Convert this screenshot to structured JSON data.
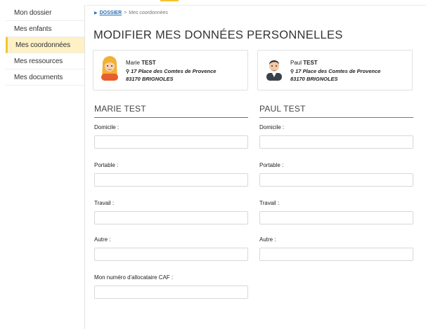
{
  "sidebar": {
    "items": [
      {
        "label": "Mon dossier",
        "active": false
      },
      {
        "label": "Mes enfants",
        "active": false
      },
      {
        "label": "Mes coordonnées",
        "active": true
      },
      {
        "label": "Mes ressources",
        "active": false
      },
      {
        "label": "Mes documents",
        "active": false
      }
    ]
  },
  "breadcrumb": {
    "root": "DOSSIER",
    "sep": ">",
    "current": "Mes coordonnées"
  },
  "page": {
    "title": "MODIFIER MES DONNÉES PERSONNELLES"
  },
  "cards": [
    {
      "first": "Marie",
      "last": "TEST",
      "street": "17 Place des Comtes de Provence",
      "city": "83170 BRIGNOLES",
      "avatar": "female-avatar-icon"
    },
    {
      "first": "Paul",
      "last": "TEST",
      "street": "17 Place des Comtes de Provence",
      "city": "83170 BRIGNOLES",
      "avatar": "male-avatar-icon"
    }
  ],
  "forms": [
    {
      "title": "MARIE TEST",
      "rule_color": "#c0504d",
      "fields": [
        {
          "label": "Domicile :",
          "value": ""
        },
        {
          "label": "Portable :",
          "value": ""
        },
        {
          "label": "Travail :",
          "value": ""
        },
        {
          "label": "Autre :",
          "value": ""
        },
        {
          "label": "Mon numéro d'allocataire CAF :",
          "value": ""
        }
      ]
    },
    {
      "title": "PAUL TEST",
      "rule_color": "#4f81bd",
      "fields": [
        {
          "label": "Domicile :",
          "value": ""
        },
        {
          "label": "Portable :",
          "value": ""
        },
        {
          "label": "Travail :",
          "value": ""
        },
        {
          "label": "Autre :",
          "value": ""
        }
      ]
    }
  ],
  "colors": {
    "accent": "#f4c431",
    "active_bg": "#fdf1c5",
    "link": "#2a6fb5"
  }
}
